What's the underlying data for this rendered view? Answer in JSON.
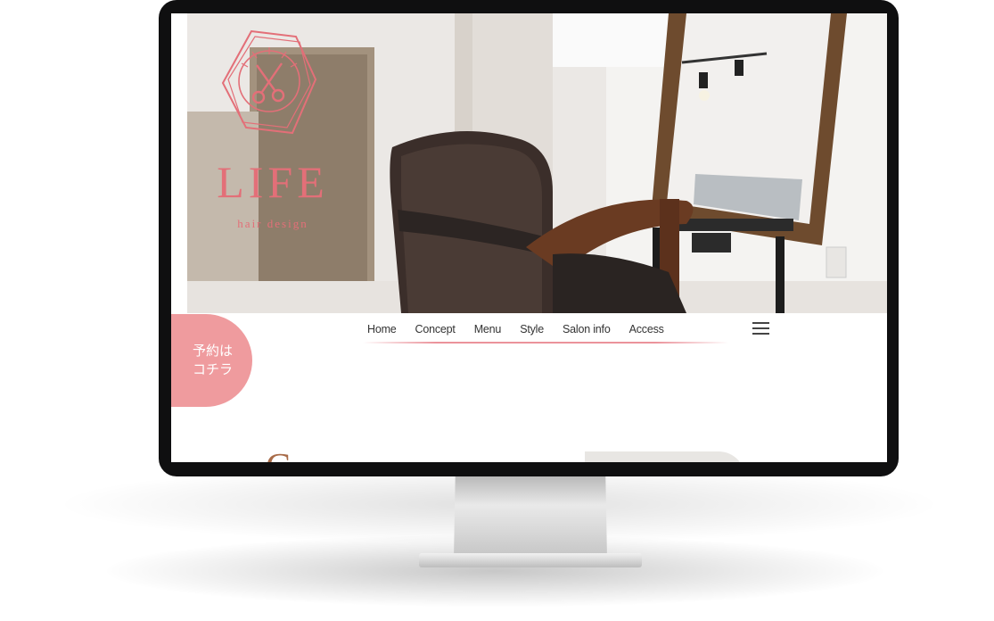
{
  "logo": {
    "title": "LIFE",
    "subtitle": "hair design",
    "icon": "scissors-hexagon-icon",
    "color": "#e36f78"
  },
  "nav": {
    "items": [
      {
        "label": "Home"
      },
      {
        "label": "Concept"
      },
      {
        "label": "Menu"
      },
      {
        "label": "Style"
      },
      {
        "label": "Salon info"
      },
      {
        "label": "Access"
      }
    ],
    "menu_icon": "hamburger-icon"
  },
  "reserve": {
    "line1": "予約は",
    "line2": "コチラ",
    "color": "#ef9b9e"
  },
  "peek": {
    "letter": "C"
  }
}
